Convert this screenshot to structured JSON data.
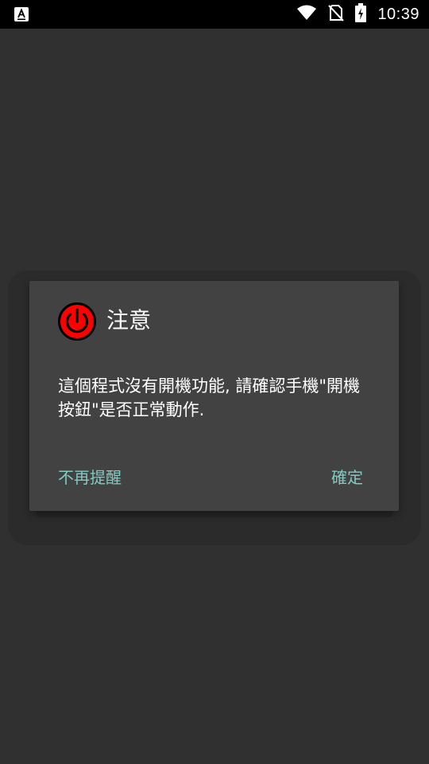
{
  "status_bar": {
    "time": "10:39",
    "icons": [
      "notification-a-icon",
      "wifi-icon",
      "no-sim-icon",
      "battery-charging-icon"
    ]
  },
  "dialog": {
    "icon": "power-icon",
    "title": "注意",
    "message": "這個程式沒有開機功能, 請確認手機\"開機按鈕\"是否正常動作.",
    "neutral_button": "不再提醒",
    "positive_button": "確定"
  },
  "colors": {
    "background": "#303030",
    "dialog": "#424242",
    "accent": "#80cbc4",
    "power_icon": "#ff0000"
  }
}
